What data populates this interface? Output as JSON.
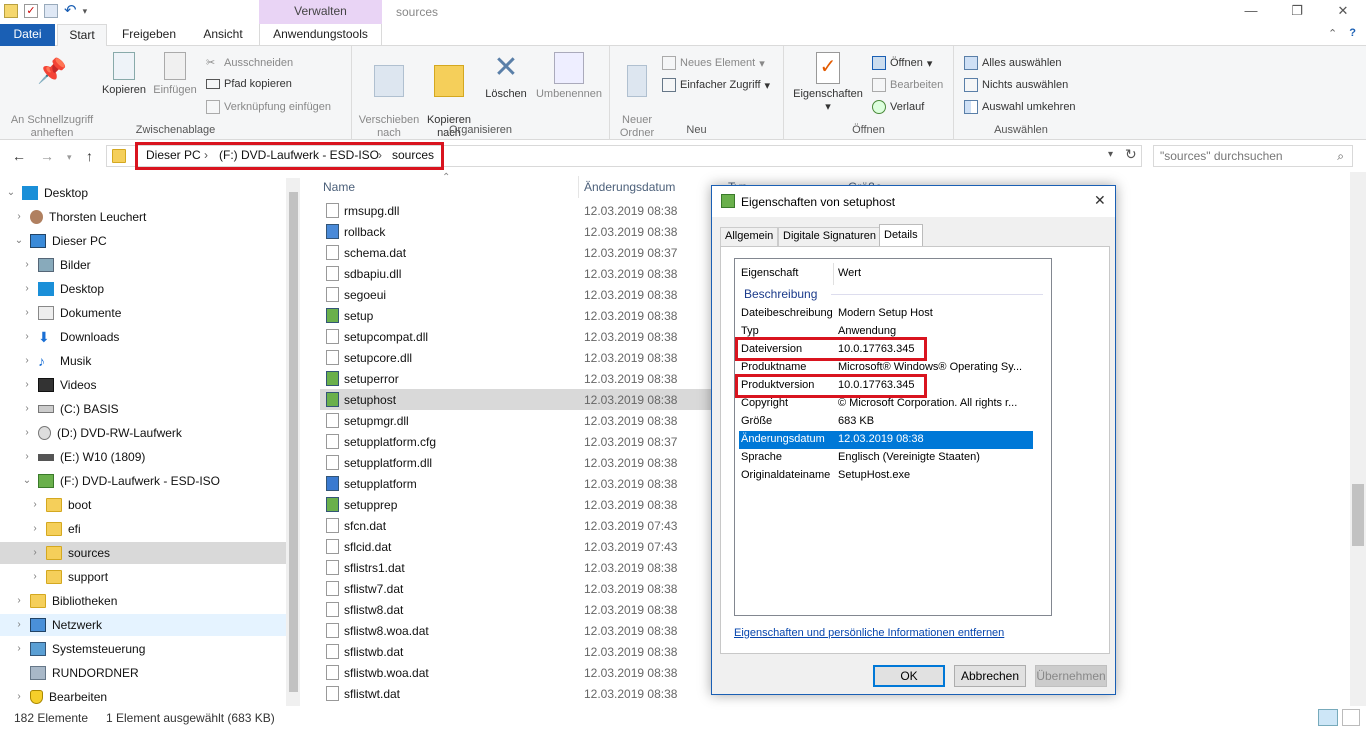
{
  "window": {
    "title": "sources",
    "context_tab": "Verwalten"
  },
  "tabs": {
    "datei": "Datei",
    "start": "Start",
    "freigeben": "Freigeben",
    "ansicht": "Ansicht",
    "anwendungstools": "Anwendungstools"
  },
  "ribbon": {
    "zwischenablage": {
      "label": "Zwischenablage",
      "pin": "An Schnellzugriff\nanheften",
      "copy": "Kopieren",
      "paste": "Einfügen",
      "cut": "Ausschneiden",
      "copy_path": "Pfad kopieren",
      "paste_shortcut": "Verknüpfung einfügen"
    },
    "organisieren": {
      "label": "Organisieren",
      "move": "Verschieben\nnach",
      "copyto": "Kopieren\nnach",
      "delete": "Löschen",
      "rename": "Umbenennen"
    },
    "neu": {
      "label": "Neu",
      "new_folder": "Neuer\nOrdner",
      "new_item": "Neues Element",
      "easy_access": "Einfacher Zugriff"
    },
    "oeffnen": {
      "label": "Öffnen",
      "properties": "Eigenschaften",
      "open": "Öffnen",
      "edit": "Bearbeiten",
      "history": "Verlauf"
    },
    "auswaehlen": {
      "label": "Auswählen",
      "select_all": "Alles auswählen",
      "select_none": "Nichts auswählen",
      "invert": "Auswahl umkehren"
    }
  },
  "address": {
    "crumbs": [
      "Dieser PC",
      "(F:) DVD-Laufwerk - ESD-ISO",
      "sources"
    ],
    "search_placeholder": "\"sources\" durchsuchen"
  },
  "nav": [
    {
      "label": "Desktop"
    },
    {
      "label": "Thorsten Leuchert"
    },
    {
      "label": "Dieser PC"
    },
    {
      "label": "Bilder"
    },
    {
      "label": "Desktop"
    },
    {
      "label": "Dokumente"
    },
    {
      "label": "Downloads"
    },
    {
      "label": "Musik"
    },
    {
      "label": "Videos"
    },
    {
      "label": "(C:) BASIS"
    },
    {
      "label": "(D:) DVD-RW-Laufwerk"
    },
    {
      "label": "(E:) W10 (1809)"
    },
    {
      "label": "(F:) DVD-Laufwerk - ESD-ISO"
    },
    {
      "label": "boot"
    },
    {
      "label": "efi"
    },
    {
      "label": "sources"
    },
    {
      "label": "support"
    },
    {
      "label": "Bibliotheken"
    },
    {
      "label": "Netzwerk"
    },
    {
      "label": "Systemsteuerung"
    },
    {
      "label": "RUNDORDNER"
    },
    {
      "label": "Bearbeiten"
    }
  ],
  "columns": {
    "name": "Name",
    "date": "Änderungsdatum",
    "type": "Typ",
    "size": "Größe"
  },
  "files": [
    {
      "name": "rmsupg.dll",
      "date": "12.03.2019 08:38"
    },
    {
      "name": "rollback",
      "date": "12.03.2019 08:38"
    },
    {
      "name": "schema.dat",
      "date": "12.03.2019 08:37"
    },
    {
      "name": "sdbapiu.dll",
      "date": "12.03.2019 08:38"
    },
    {
      "name": "segoeui",
      "date": "12.03.2019 08:38"
    },
    {
      "name": "setup",
      "date": "12.03.2019 08:38"
    },
    {
      "name": "setupcompat.dll",
      "date": "12.03.2019 08:38"
    },
    {
      "name": "setupcore.dll",
      "date": "12.03.2019 08:38"
    },
    {
      "name": "setuperror",
      "date": "12.03.2019 08:38"
    },
    {
      "name": "setuphost",
      "date": "12.03.2019 08:38"
    },
    {
      "name": "setupmgr.dll",
      "date": "12.03.2019 08:38"
    },
    {
      "name": "setupplatform.cfg",
      "date": "12.03.2019 08:37"
    },
    {
      "name": "setupplatform.dll",
      "date": "12.03.2019 08:38"
    },
    {
      "name": "setupplatform",
      "date": "12.03.2019 08:38"
    },
    {
      "name": "setupprep",
      "date": "12.03.2019 08:38"
    },
    {
      "name": "sfcn.dat",
      "date": "12.03.2019 07:43"
    },
    {
      "name": "sflcid.dat",
      "date": "12.03.2019 07:43"
    },
    {
      "name": "sflistrs1.dat",
      "date": "12.03.2019 08:38"
    },
    {
      "name": "sflistw7.dat",
      "date": "12.03.2019 08:38"
    },
    {
      "name": "sflistw8.dat",
      "date": "12.03.2019 08:38"
    },
    {
      "name": "sflistw8.woa.dat",
      "date": "12.03.2019 08:38"
    },
    {
      "name": "sflistwb.dat",
      "date": "12.03.2019 08:38"
    },
    {
      "name": "sflistwb.woa.dat",
      "date": "12.03.2019 08:38"
    },
    {
      "name": "sflistwt.dat",
      "date": "12.03.2019 08:38"
    }
  ],
  "status": {
    "count": "182 Elemente",
    "selection": "1 Element ausgewählt (683 KB)"
  },
  "dialog": {
    "title": "Eigenschaften von setuphost",
    "tabs": [
      "Allgemein",
      "Digitale Signaturen",
      "Details"
    ],
    "header": {
      "key": "Eigenschaft",
      "value": "Wert"
    },
    "section": "Beschreibung",
    "props": [
      {
        "k": "Dateibeschreibung",
        "v": "Modern Setup Host"
      },
      {
        "k": "Typ",
        "v": "Anwendung"
      },
      {
        "k": "Dateiversion",
        "v": "10.0.17763.345"
      },
      {
        "k": "Produktname",
        "v": "Microsoft® Windows® Operating Sy..."
      },
      {
        "k": "Produktversion",
        "v": "10.0.17763.345"
      },
      {
        "k": "Copyright",
        "v": "© Microsoft Corporation. All rights r..."
      },
      {
        "k": "Größe",
        "v": "683 KB"
      },
      {
        "k": "Änderungsdatum",
        "v": "12.03.2019 08:38"
      },
      {
        "k": "Sprache",
        "v": "Englisch (Vereinigte Staaten)"
      },
      {
        "k": "Originaldateiname",
        "v": "SetupHost.exe"
      }
    ],
    "remove_link": "Eigenschaften und persönliche Informationen entfernen",
    "ok": "OK",
    "cancel": "Abbrechen",
    "apply": "Übernehmen"
  },
  "colors": {
    "accent": "#1a5fb4",
    "highlight": "#d9141f",
    "selection": "#0078d7"
  }
}
